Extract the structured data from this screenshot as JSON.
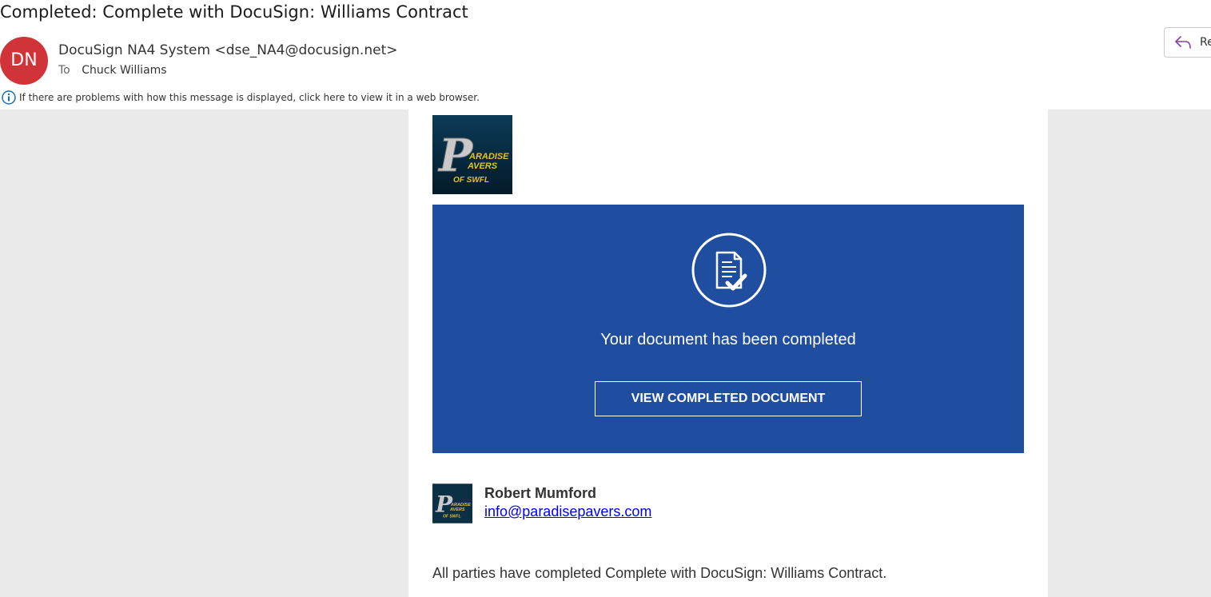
{
  "email": {
    "subject": "Completed: Complete with DocuSign: Williams Contract",
    "avatar_initials": "DN",
    "avatar_color": "#d13438",
    "sender": "DocuSign NA4 System <dse_NA4@docusign.net>",
    "to_label": "To",
    "to_name": "Chuck Williams",
    "reply_label": "Re",
    "info_text": "If there are problems with how this message is displayed, click here to view it in a web browser."
  },
  "body": {
    "logo_text": {
      "line1": "P",
      "line2": "ARADISE",
      "line3": "AVERS",
      "line4": "OF SWFL"
    },
    "banner_color": "#1f4ea1",
    "completed_text": "Your document has been completed",
    "view_button": "VIEW COMPLETED DOCUMENT",
    "sender_name": "Robert Mumford",
    "sender_email": "info@paradisepavers.com",
    "message": "All parties have completed Complete with DocuSign: Williams Contract."
  },
  "icons": [
    "reply-icon",
    "info-icon",
    "document-check-icon"
  ]
}
